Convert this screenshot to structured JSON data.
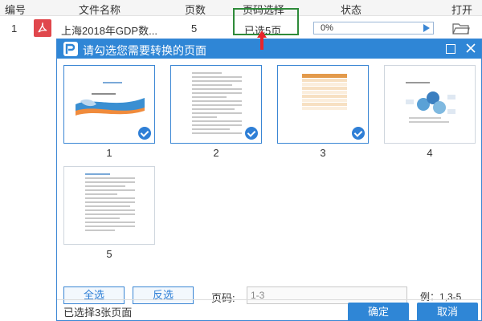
{
  "table": {
    "headers": [
      "编号",
      "文件名称",
      "页数",
      "页码选择",
      "状态",
      "打开"
    ],
    "row": {
      "index": "1",
      "filename": "上海2018年GDP数...",
      "pages": "5",
      "page_selection": "已选5页",
      "progress": "0%"
    }
  },
  "dialog": {
    "title": "请勾选您需要转换的页面",
    "thumbnails": [
      {
        "label": "1",
        "selected": true
      },
      {
        "label": "2",
        "selected": true
      },
      {
        "label": "3",
        "selected": true
      },
      {
        "label": "4",
        "selected": false
      },
      {
        "label": "5",
        "selected": false
      }
    ],
    "select_all_label": "全选",
    "invert_label": "反选",
    "page_label": "页码:",
    "page_input_value": "1-3",
    "example_text": "例：1,3-5",
    "status_text": "已选择3张页面",
    "confirm_label": "确定",
    "cancel_label": "取消"
  },
  "colors": {
    "accent": "#2f86d6",
    "annotation_box": "#2e8b3a",
    "annotation_arrow": "#e8252a",
    "pdf_icon": "#e0474c"
  },
  "icons": [
    "pdf-icon",
    "play-icon",
    "folder-icon",
    "app-logo-icon",
    "maximize-icon",
    "close-icon",
    "check-icon"
  ]
}
